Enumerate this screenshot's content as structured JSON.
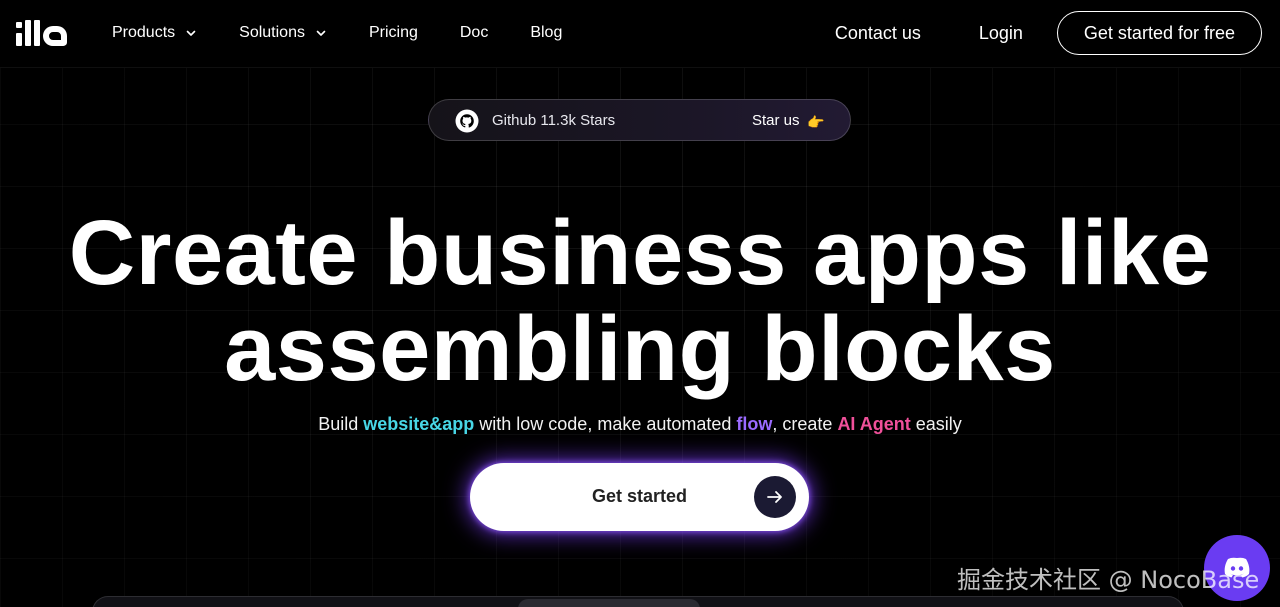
{
  "nav": {
    "logo_text": "illa",
    "products": "Products",
    "solutions": "Solutions",
    "pricing": "Pricing",
    "doc": "Doc",
    "blog": "Blog",
    "contact": "Contact us",
    "login": "Login",
    "cta": "Get started for free"
  },
  "github": {
    "text": "Github 11.3k Stars",
    "star_us": "Star us",
    "hand": "👉"
  },
  "hero": {
    "title_line1": "Create business apps like",
    "title_line2": "assembling blocks",
    "sub_pre": "Build ",
    "sub_h1": "website&app",
    "sub_mid1": " with low code, make automated ",
    "sub_h2": "flow",
    "sub_mid2": ", create ",
    "sub_h3": "AI Agent",
    "sub_post": " easily"
  },
  "cta": {
    "label": "Get started"
  },
  "watermark": "掘金技术社区 @ NocoBase",
  "colors": {
    "background": "#000000",
    "highlight_cyan": "#48d7e6",
    "highlight_purple": "#9b6bff",
    "highlight_pink": "#f0509a",
    "cta_glow": "#7c3cff",
    "chat_fab": "#6a3cf2"
  },
  "icons": {
    "github": "github-icon",
    "chevron": "chevron-down-icon",
    "arrow": "arrow-right-icon",
    "chat": "discord-icon"
  }
}
